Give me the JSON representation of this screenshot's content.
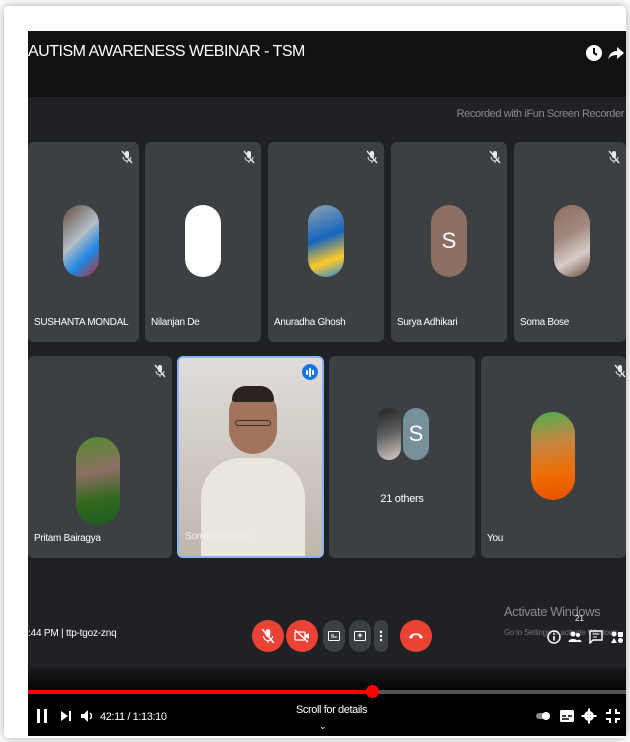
{
  "window": {
    "title": "AUTISM AWARENESS WEBINAR - TSM",
    "icons": [
      "clock-icon",
      "share-icon"
    ]
  },
  "watermark": "Recorded with iFun Screen Recorder",
  "participants": [
    {
      "name": "SUSHANTA MONDAL",
      "avatar": "photo",
      "muted": true
    },
    {
      "name": "Nilanjan De",
      "avatar": "white-circle",
      "muted": true
    },
    {
      "name": "Anuradha Ghosh",
      "avatar": "photo",
      "muted": true
    },
    {
      "name": "Surya Adhikari",
      "avatar": "letter",
      "letter": "S",
      "avatar_color": "#8d6e63",
      "muted": true
    },
    {
      "name": "Soma Bose",
      "avatar": "photo",
      "muted": true
    },
    {
      "name": "Pritam Bairagya",
      "avatar": "photo",
      "muted": true
    },
    {
      "name": "Sommath Gosh",
      "avatar": "video",
      "muted": false,
      "speaking": true
    },
    {
      "name": "21 others",
      "avatar": "group",
      "letter": "S",
      "avatar_color": "#78909c"
    },
    {
      "name": "You",
      "avatar": "photo",
      "muted": true
    }
  ],
  "meeting": {
    "time_and_code": ":44 PM  |  ttp-tgoz-znq",
    "people_count": "21"
  },
  "controls": [
    "mic-off-button",
    "camera-off-button",
    "captions-button",
    "present-button",
    "more-options-button",
    "leave-call-button"
  ],
  "activate_windows": {
    "title": "Activate Windows",
    "subtitle": "Go to Settings to activate Windows."
  },
  "player": {
    "time": "42:11 / 1:13:10",
    "scroll_hint": "Scroll for details",
    "progress": 0.575
  },
  "colors": {
    "accent_red": "#ea4335",
    "speaker_border": "#8ab4f8",
    "tile_bg": "#3c4043",
    "youtube_red": "#ff0000"
  }
}
